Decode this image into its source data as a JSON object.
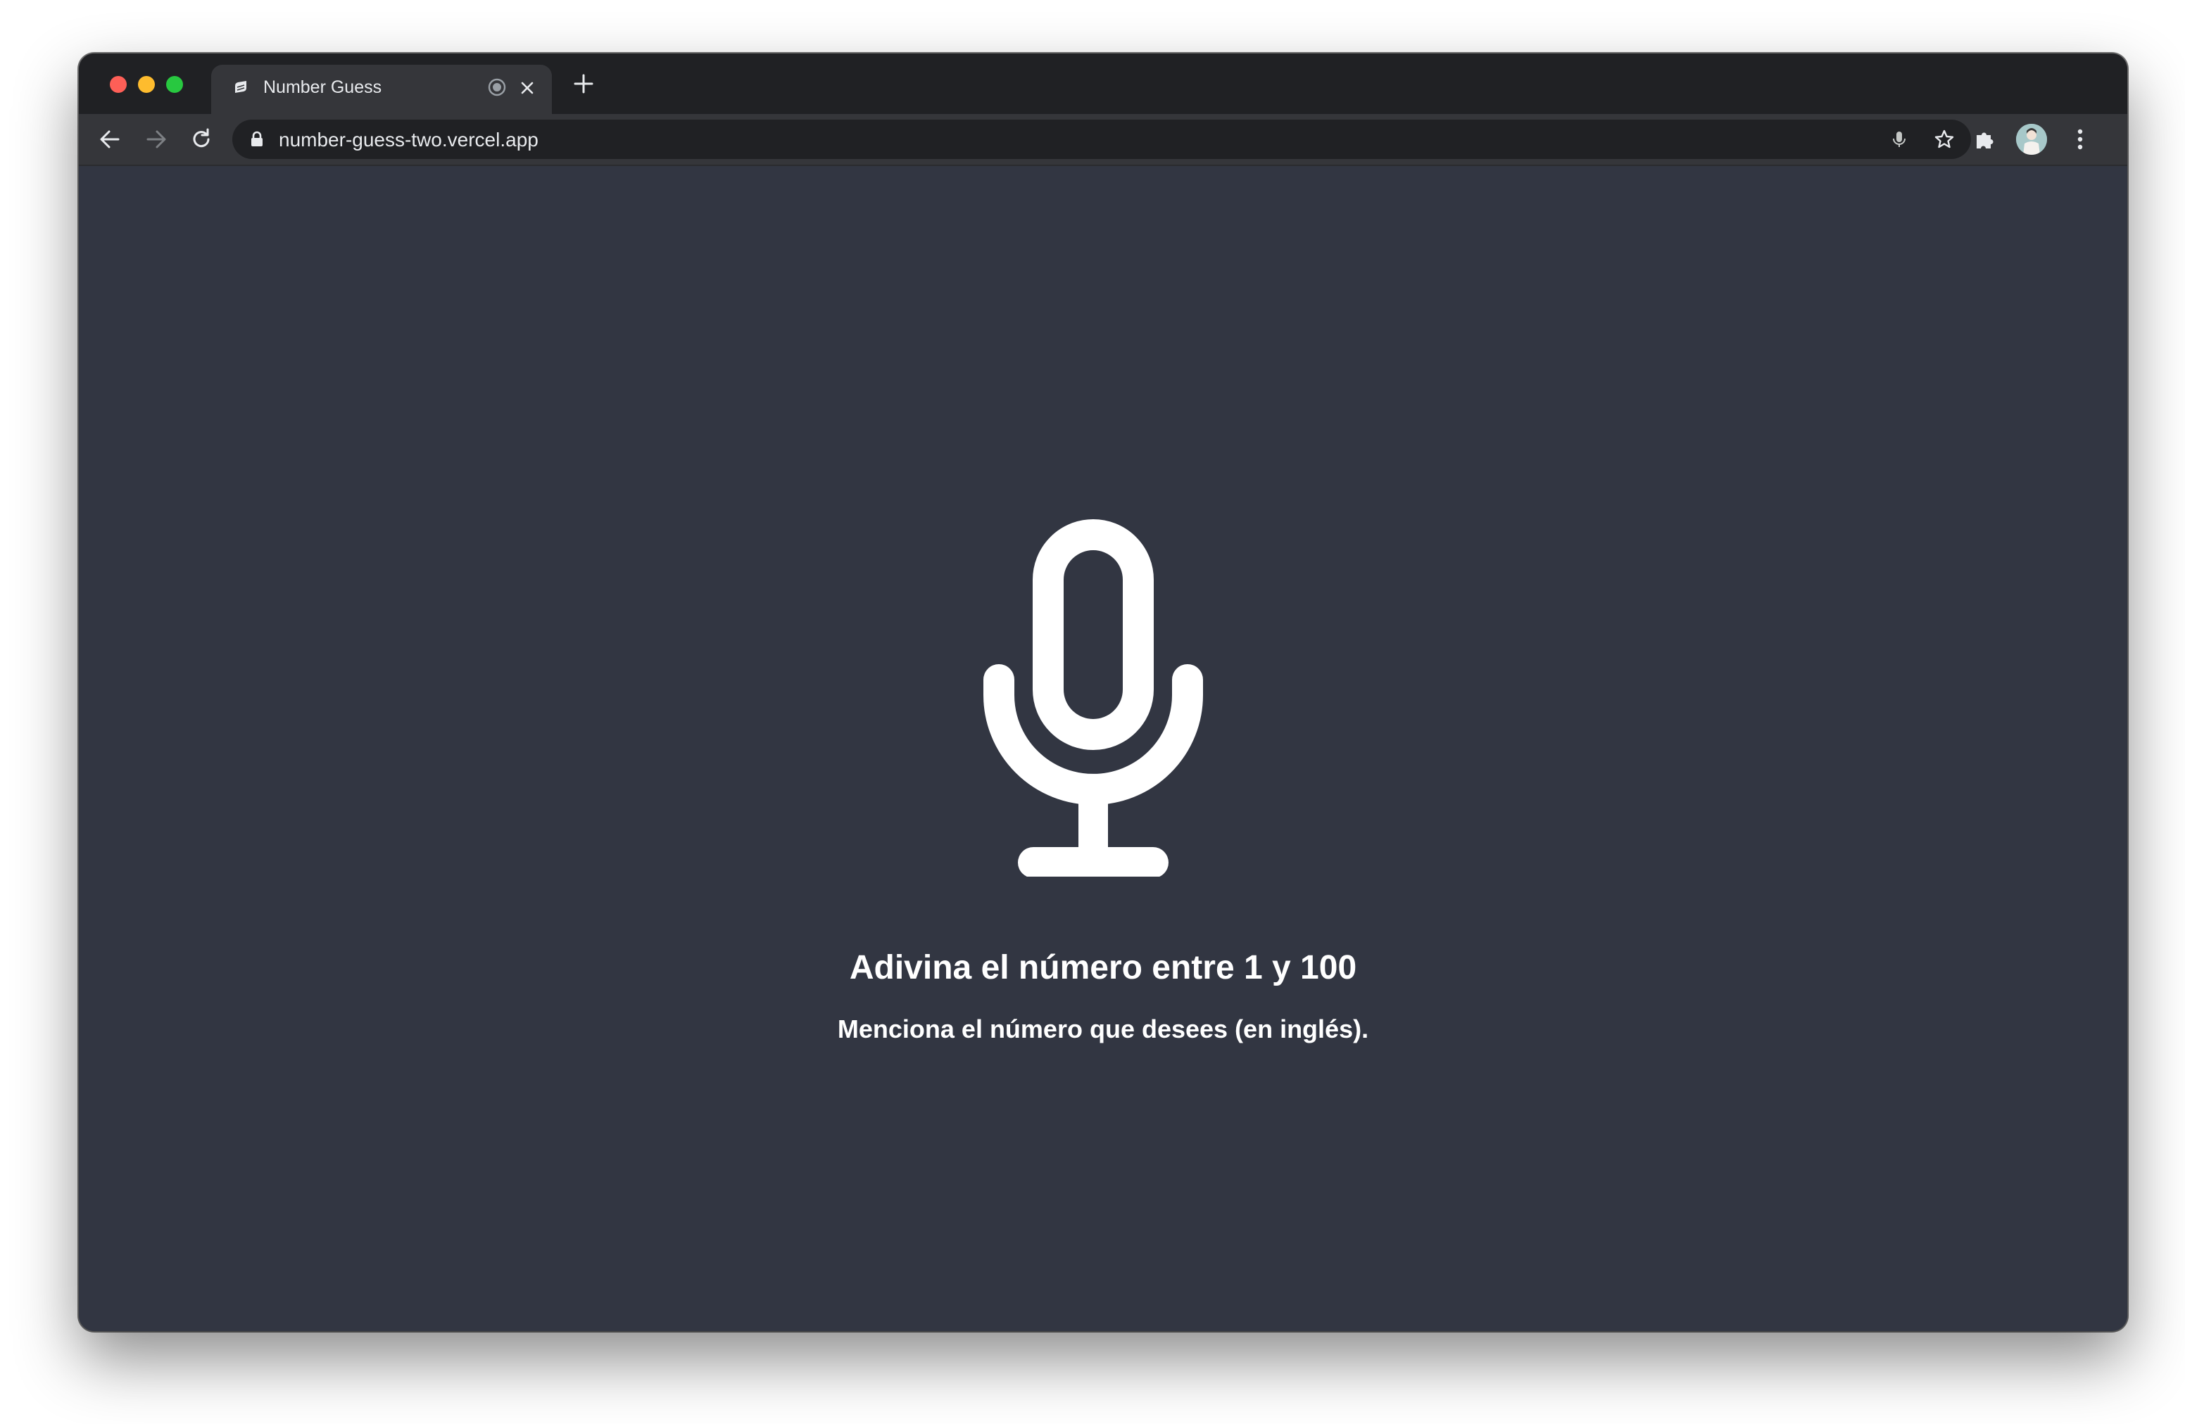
{
  "browser": {
    "tab": {
      "title": "Number Guess",
      "favicon": "vercel-app-icon"
    },
    "address_bar": {
      "url": "number-guess-two.vercel.app"
    },
    "icons": {
      "back": "arrow-left-icon",
      "forward": "arrow-right-icon",
      "reload": "reload-icon",
      "lock": "lock-icon",
      "mic": "microphone-icon",
      "bookmark": "star-icon",
      "extensions": "puzzle-icon",
      "menu": "more-vert-icon"
    }
  },
  "page": {
    "heading": "Adivina el número entre 1 y 100",
    "subheading": "Menciona el número que desees (en inglés).",
    "mic_icon": "microphone-icon"
  },
  "colors": {
    "page_background": "#323642",
    "text": "#ffffff",
    "chrome_dark": "#202124",
    "chrome_toolbar": "#35363a"
  }
}
